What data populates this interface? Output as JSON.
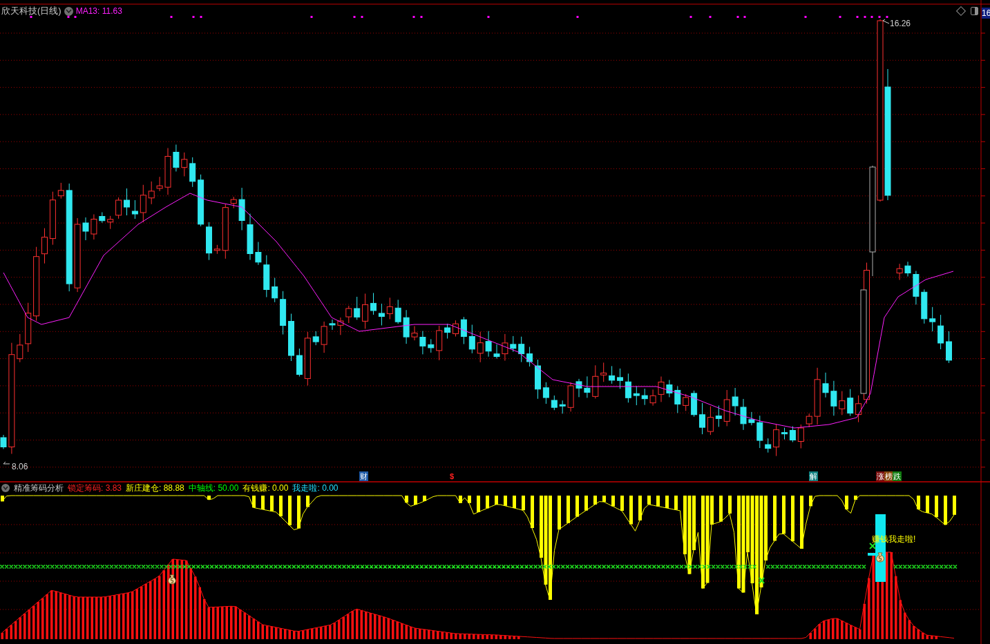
{
  "chart_header": {
    "title": "欣天科技(日线)",
    "ma_label": "MA13: 11.63"
  },
  "price_labels": {
    "high": "16.26",
    "low": "8.06"
  },
  "axis_tag": "16",
  "event_markers": [
    {
      "kind": "boxed",
      "text": "财",
      "color": "#1e5aa8"
    },
    {
      "kind": "plain",
      "text": "$",
      "color": "#ff2020"
    },
    {
      "kind": "boxed",
      "text": "解",
      "color": "#108080"
    },
    {
      "kind": "boxed",
      "text": "涨",
      "color": "#7a1010"
    },
    {
      "kind": "boxed",
      "text": "榜",
      "color": "#8a4a10"
    },
    {
      "kind": "boxed",
      "text": "跌",
      "color": "#107a10"
    }
  ],
  "indicator": {
    "title": "精准筹码分析",
    "values": [
      {
        "label": "锁定筹码:",
        "value": "3.83",
        "color": "#ff2020"
      },
      {
        "label": "新庄建仓:",
        "value": "88.88",
        "color": "#ffff00"
      },
      {
        "label": "中轴线:",
        "value": "50.00",
        "color": "#00ff00"
      },
      {
        "label": "有钱赚:",
        "value": "0.00",
        "color": "#ffff00"
      },
      {
        "label": "我走啦:",
        "value": "0.00",
        "color": "#20e0ff"
      }
    ],
    "signal_text": "赚钱我走啦!"
  }
}
